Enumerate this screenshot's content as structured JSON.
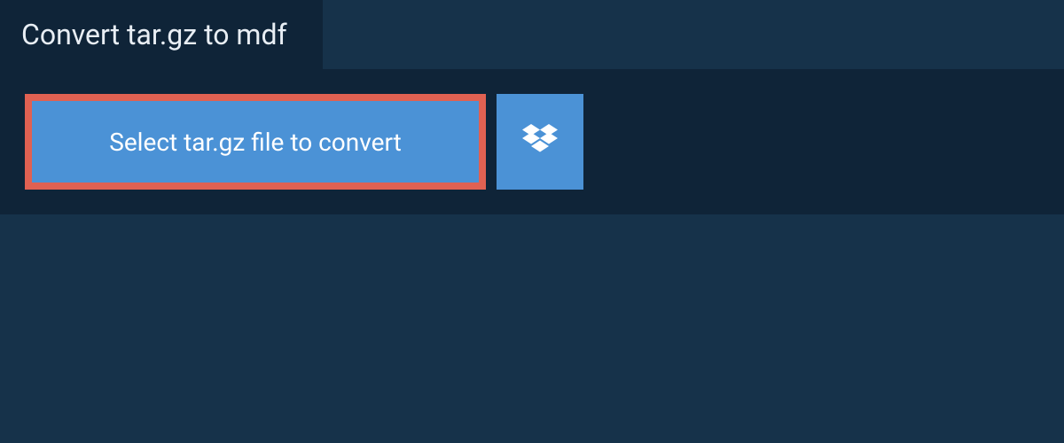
{
  "header": {
    "title": "Convert tar.gz to mdf"
  },
  "actions": {
    "select_file_label": "Select tar.gz file to convert"
  },
  "icons": {
    "dropbox": "dropbox-icon"
  }
}
